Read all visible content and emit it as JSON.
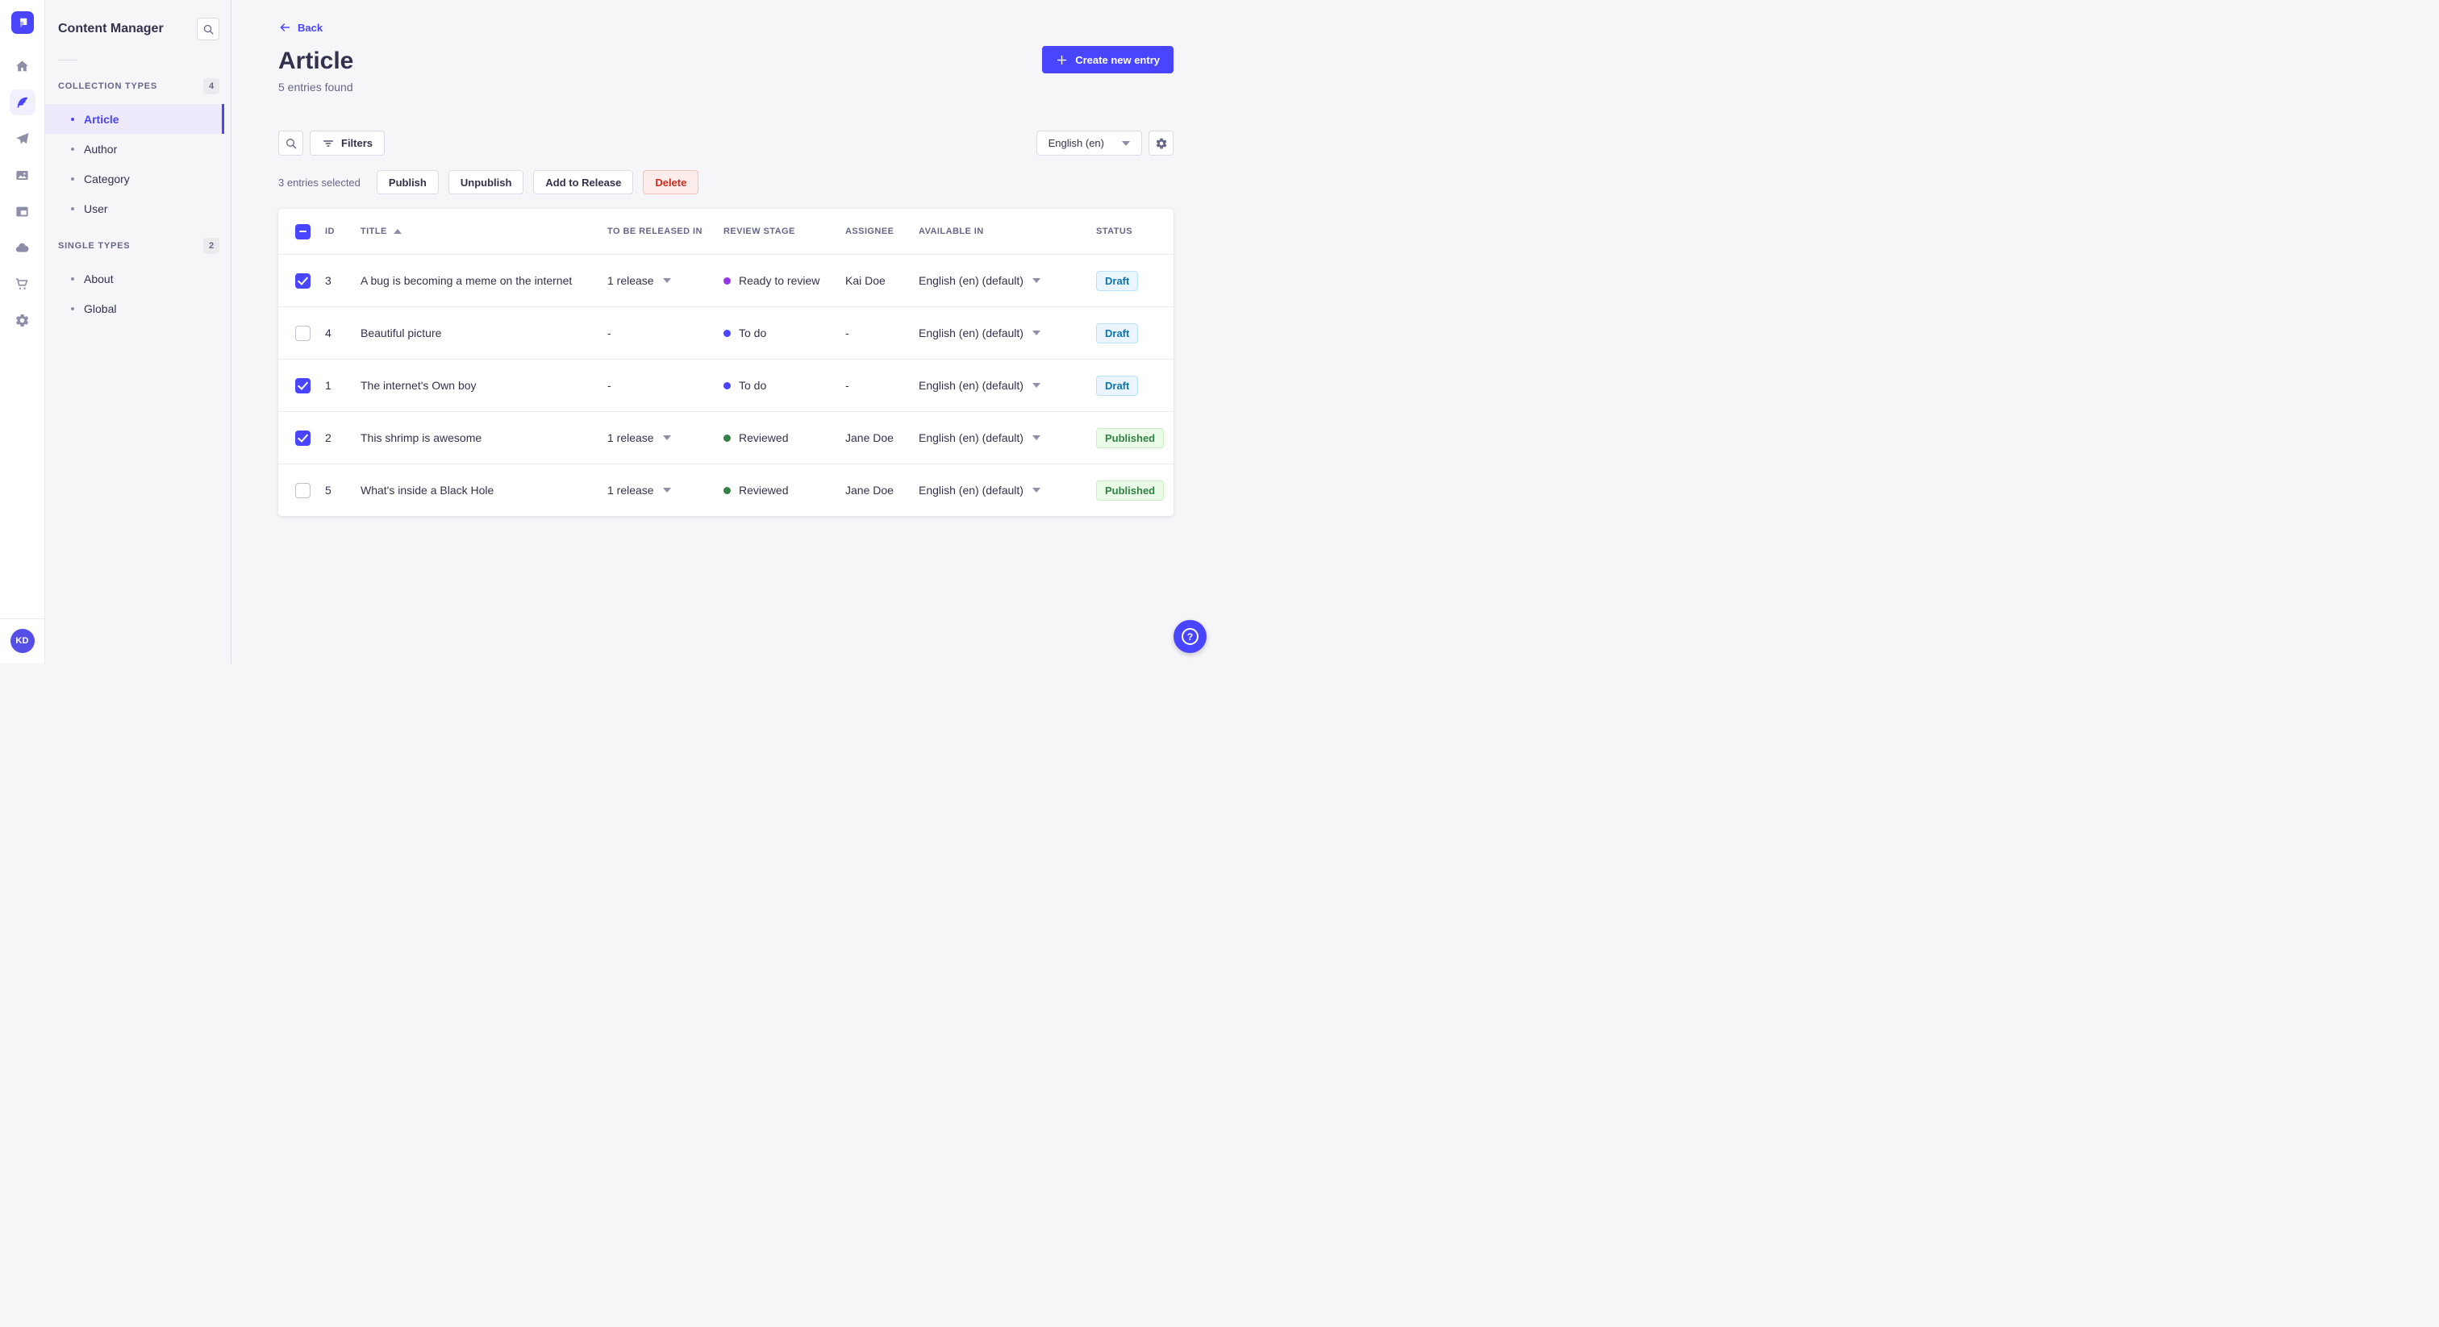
{
  "app": {
    "name": "Strapi admin"
  },
  "main_nav": {
    "items": [
      {
        "icon": "home-icon",
        "active": false
      },
      {
        "icon": "content-manager-icon",
        "active": true
      },
      {
        "icon": "releases-icon",
        "active": false
      },
      {
        "icon": "media-library-icon",
        "active": false
      },
      {
        "icon": "content-type-builder-icon",
        "active": false
      },
      {
        "icon": "deploy-icon",
        "active": false
      },
      {
        "icon": "marketplace-icon",
        "active": false
      },
      {
        "icon": "settings-icon",
        "active": false
      }
    ],
    "avatar_initials": "KD"
  },
  "subnav": {
    "title": "Content Manager",
    "sections": [
      {
        "label": "COLLECTION TYPES",
        "count": "4",
        "items": [
          {
            "label": "Article",
            "active": true
          },
          {
            "label": "Author",
            "active": false
          },
          {
            "label": "Category",
            "active": false
          },
          {
            "label": "User",
            "active": false
          }
        ]
      },
      {
        "label": "SINGLE TYPES",
        "count": "2",
        "items": [
          {
            "label": "About",
            "active": false
          },
          {
            "label": "Global",
            "active": false
          }
        ]
      }
    ]
  },
  "header": {
    "back_label": "Back",
    "title": "Article",
    "subtitle": "5 entries found",
    "create_label": "Create new entry"
  },
  "toolbar": {
    "filters_label": "Filters",
    "locale": "English (en)"
  },
  "selection": {
    "summary": "3 entries selected",
    "publish_label": "Publish",
    "unpublish_label": "Unpublish",
    "add_to_release_label": "Add to Release",
    "delete_label": "Delete"
  },
  "table": {
    "headers": {
      "id": "ID",
      "title": "TITLE",
      "released": "TO BE RELEASED IN",
      "review": "REVIEW STAGE",
      "assignee": "ASSIGNEE",
      "available": "AVAILABLE IN",
      "status": "STATUS"
    },
    "sort": {
      "column": "TITLE",
      "direction": "ascending"
    },
    "header_checkbox": "indeterminate",
    "rows": [
      {
        "checkbox": "checked",
        "id": "3",
        "title": "A bug is becoming a meme on the internet",
        "released": "1 release",
        "released_caret": "true",
        "stage": "ready",
        "stage_label": "Ready to review",
        "assignee": "Kai Doe",
        "available": "English (en) (default)",
        "status": "Draft",
        "status_key": "draft"
      },
      {
        "checkbox": "unchecked",
        "id": "4",
        "title": "Beautiful picture",
        "released": "-",
        "released_caret": "false",
        "stage": "todo",
        "stage_label": "To do",
        "assignee": "-",
        "available": "English (en) (default)",
        "status": "Draft",
        "status_key": "draft"
      },
      {
        "checkbox": "checked",
        "id": "1",
        "title": "The internet's Own boy",
        "released": "-",
        "released_caret": "false",
        "stage": "todo",
        "stage_label": "To do",
        "assignee": "-",
        "available": "English (en) (default)",
        "status": "Draft",
        "status_key": "draft"
      },
      {
        "checkbox": "checked",
        "id": "2",
        "title": "This shrimp is awesome",
        "released": "1 release",
        "released_caret": "true",
        "stage": "reviewed",
        "stage_label": "Reviewed",
        "assignee": "Jane Doe",
        "available": "English (en) (default)",
        "status": "Published",
        "status_key": "published"
      },
      {
        "checkbox": "unchecked",
        "id": "5",
        "title": "What's inside a Black Hole",
        "released": "1 release",
        "released_caret": "true",
        "stage": "reviewed",
        "stage_label": "Reviewed",
        "assignee": "Jane Doe",
        "available": "English (en) (default)",
        "status": "Published",
        "status_key": "published"
      }
    ]
  },
  "help": {
    "glyph": "?"
  },
  "colors": {
    "primary": "#4945ff",
    "primary_light": "#f0f0ff",
    "page_bg": "#f6f6f9",
    "stage_ready_to_review": "#9736e8",
    "stage_todo": "#4945ff",
    "stage_reviewed": "#328048",
    "draft_bg": "#eaf5ff",
    "draft_border": "#b8e1ff",
    "draft_text": "#0c75af",
    "published_bg": "#eafbe7",
    "published_border": "#c6f0c2",
    "published_text": "#328048",
    "delete_bg": "#fcecea",
    "delete_border": "#f5c0b8",
    "delete_text": "#d02b20"
  }
}
